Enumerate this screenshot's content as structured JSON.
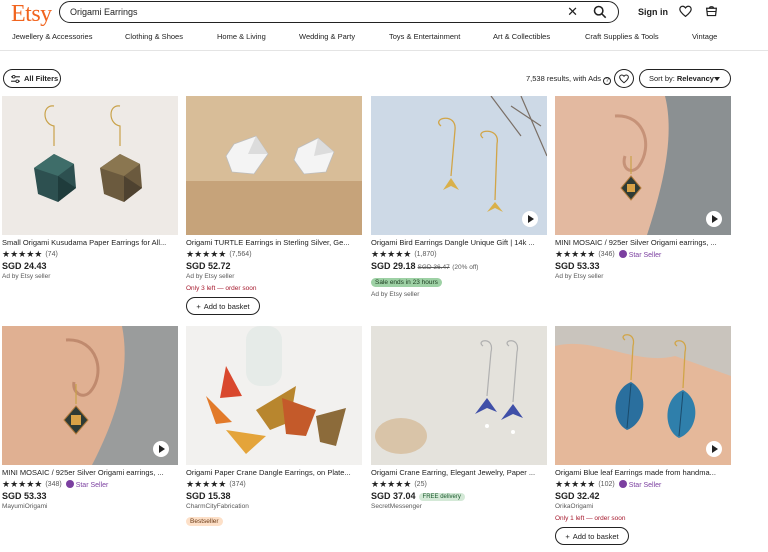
{
  "header": {
    "logo": "Etsy",
    "search_value": "Origami Earrings",
    "sign_in": "Sign in",
    "clear_icon": "close-icon",
    "search_icon": "search-icon"
  },
  "nav": {
    "items": [
      {
        "label": "Jewellery & Accessories"
      },
      {
        "label": "Clothing & Shoes"
      },
      {
        "label": "Home & Living"
      },
      {
        "label": "Wedding & Party"
      },
      {
        "label": "Toys & Entertainment"
      },
      {
        "label": "Art & Collectibles"
      },
      {
        "label": "Craft Supplies & Tools"
      },
      {
        "label": "Vintage"
      }
    ]
  },
  "toolbar": {
    "all_filters": "All Filters",
    "results": "7,538 results, with Ads",
    "sort_label": "Sort by:",
    "sort_value": "Relevancy"
  },
  "listings": [
    {
      "title": "Small Origami Kusudama Paper Earrings for All...",
      "stars": "★★★★★",
      "reviews": "(74)",
      "price": "SGD 24.43",
      "seller": "Ad by Etsy seller"
    },
    {
      "title": "Origami TURTLE Earrings in Sterling Silver, Ge...",
      "stars": "★★★★★",
      "reviews": "(7,564)",
      "price": "SGD 52.72",
      "seller": "Ad by Etsy seller",
      "stock": "Only 3 left — order soon",
      "basket": "Add to basket"
    },
    {
      "title": "Origami Bird Earrings Dangle Unique Gift | 14k ...",
      "stars": "★★★★★",
      "reviews": "(1,870)",
      "price": "SGD 29.18",
      "old_price": "SGD 36.47",
      "off": "(20% off)",
      "sale": "Sale ends in 23 hours",
      "seller": "Ad by Etsy seller"
    },
    {
      "title": "MINI MOSAIC / 925er Silver Origami earrings, ...",
      "stars": "★★★★★",
      "reviews": "(346)",
      "star_seller": "Star Seller",
      "price": "SGD 53.33",
      "seller": "Ad by Etsy seller"
    },
    {
      "title": "MINI MOSAIC / 925er Silver Origami earrings, ...",
      "stars": "★★★★★",
      "reviews": "(348)",
      "star_seller": "Star Seller",
      "price": "SGD 53.33",
      "seller": "MayumiOrigami"
    },
    {
      "title": "Origami Paper Crane Dangle Earrings, on Plate...",
      "stars": "★★★★★",
      "reviews": "(374)",
      "price": "SGD 15.38",
      "seller": "CharmCityFabrication",
      "badge": "Bestseller"
    },
    {
      "title": "Origami Crane Earring, Elegant Jewelry, Paper ...",
      "stars": "★★★★★",
      "reviews": "(25)",
      "price": "SGD 37.04",
      "free": "FREE delivery",
      "seller": "SecretMessenger"
    },
    {
      "title": "Origami Blue leaf Earrings made from handma...",
      "stars": "★★★★★",
      "reviews": "(102)",
      "star_seller": "Star Seller",
      "price": "SGD 32.42",
      "seller": "OrikaOrigami",
      "stock": "Only 1 left — order soon",
      "basket": "Add to basket"
    }
  ],
  "colors": {
    "brand": "#f1641e",
    "star_seller": "#7b3fa0",
    "stock_warning": "#a61a2e",
    "sale_badge": "#9ed1a5"
  }
}
